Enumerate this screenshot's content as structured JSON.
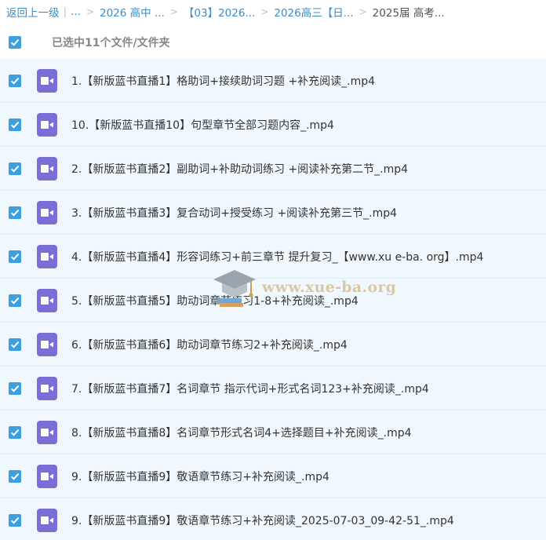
{
  "breadcrumb": {
    "back": "返回上一级",
    "ellipsis": "...",
    "items": [
      "2026 高中 ...",
      "【03】2026...",
      "2026高三【日...",
      "2025届 高考..."
    ]
  },
  "header": {
    "selection_count": "已选中11个文件/文件夹"
  },
  "files": [
    "1.【新版蓝书直播1】格助词+接续助词习题 +补充阅读_.mp4",
    "10.【新版蓝书直播10】句型章节全部习题内容_.mp4",
    "2.【新版蓝书直播2】副助词+补助动词练习 +阅读补充第二节_.mp4",
    "3.【新版蓝书直播3】复合动词+授受练习 +阅读补充第三节_.mp4",
    "4.【新版蓝书直播4】形容词练习+前三章节 提升复习_【www.xu e-ba. org】.mp4",
    "5.【新版蓝书直播5】助动词章节练习1-8+补充阅读_.mp4",
    "6.【新版蓝书直播6】助动词章节练习2+补充阅读_.mp4",
    "7.【新版蓝书直播7】名词章节 指示代词+形式名词123+补充阅读_.mp4",
    "8.【新版蓝书直播8】名词章节形式名词4+选择题目+补充阅读_.mp4",
    "9.【新版蓝书直播9】敬语章节练习+补充阅读_.mp4",
    "9.【新版蓝书直播9】敬语章节练习+补充阅读_2025-07-03_09-42-51_.mp4"
  ],
  "icons": {
    "checkbox": "checkbox-checked-icon",
    "file": "video-file-icon"
  },
  "watermark": {
    "text": "www.xue-ba.org"
  },
  "colors": {
    "link": "#3b8cc9",
    "checkbox": "#3b9fe0",
    "video_icon": "#7b6fd6",
    "row_background": "#f0f8fe"
  }
}
